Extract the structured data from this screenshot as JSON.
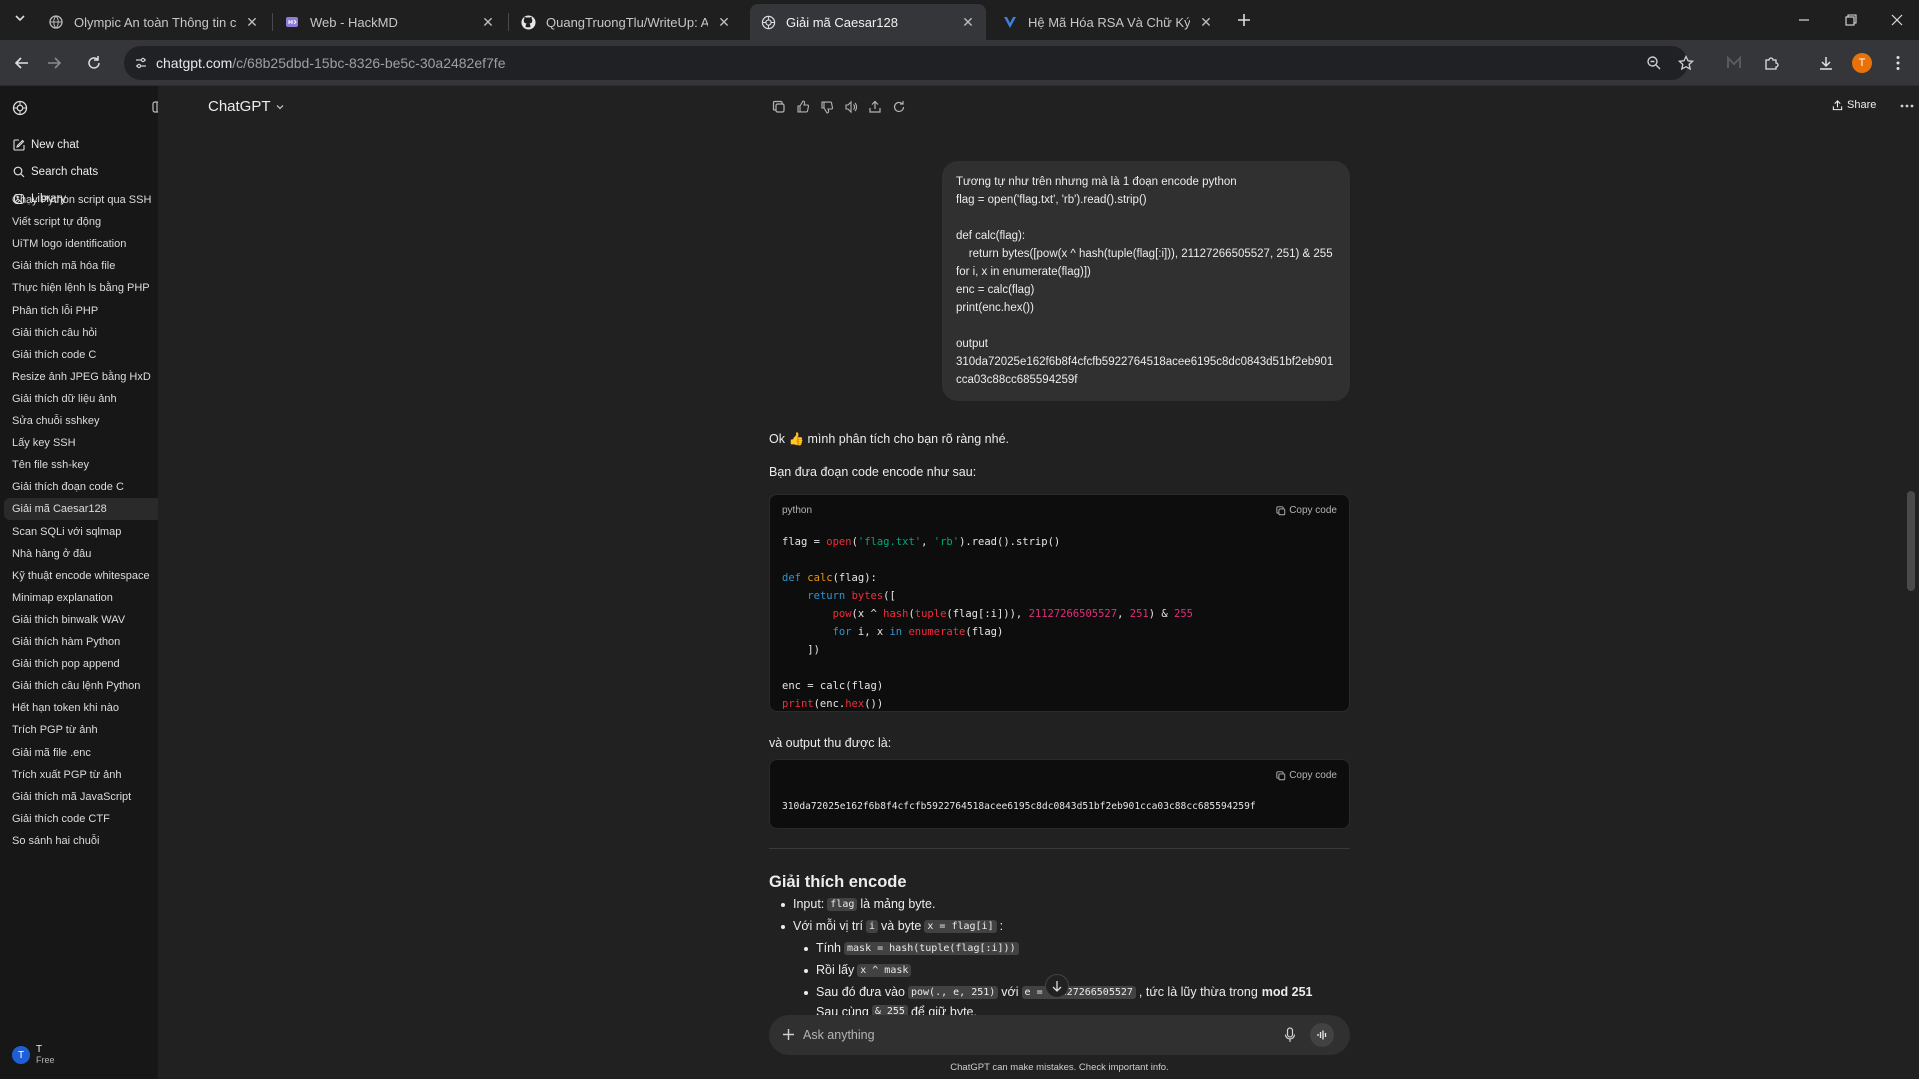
{
  "browser": {
    "tabs": [
      {
        "title": "Olympic An toàn Thông tin cấp",
        "active": false
      },
      {
        "title": "Web - HackMD",
        "active": false
      },
      {
        "title": "QuangTruongTlu/WriteUp: A pl",
        "active": false
      },
      {
        "title": "Giải mã Caesar128",
        "active": true
      },
      {
        "title": "Hệ Mã Hóa RSA Và Chữ Ký Số -",
        "active": false
      }
    ],
    "url_host": "chatgpt.com",
    "url_path": "/c/68b25dbd-15bc-8326-be5c-30a2482ef7fe",
    "profile_initial": "T"
  },
  "sidebar": {
    "new_chat": "New chat",
    "search_chats": "Search chats",
    "library": "Library",
    "chats": [
      "Chạy Python script qua SSH",
      "Viết script tự động",
      "UiTM logo identification",
      "Giải thích mã hóa file",
      "Thực hiện lệnh ls bằng PHP",
      "Phân tích lỗi PHP",
      "Giải thích câu hỏi",
      "Giải thích code C",
      "Resize ảnh JPEG bằng HxD",
      "Giải thích dữ liệu ảnh",
      "Sửa chuỗi sshkey",
      "Lấy key SSH",
      "Tên file ssh-key",
      "Giải thích đoạn code C",
      "Giải mã Caesar128",
      "Scan SQLi với sqlmap",
      "Nhà hàng ở đâu",
      "Kỹ thuật encode whitespace",
      "Minimap explanation",
      "Giải thích binwalk WAV",
      "Giải thích hàm Python",
      "Giải thích pop append",
      "Giải thích câu lệnh Python",
      "Hết hạn token khi nào",
      "Trích PGP từ ảnh",
      "Giải mã file .enc",
      "Trích xuất PGP từ ảnh",
      "Giải thích mã JavaScript",
      "Giải thích code CTF",
      "So sánh hai chuỗi"
    ],
    "active_chat_index": 14,
    "user_initial": "T",
    "user_name": "T",
    "user_plan": "Free"
  },
  "header": {
    "model": "ChatGPT",
    "share": "Share"
  },
  "conversation": {
    "user_message": "Tương tự như trên nhưng mà là 1 đoạn encode python\nflag = open('flag.txt', 'rb').read().strip()\n\ndef calc(flag):\n    return bytes([pow(x ^ hash(tuple(flag[:i])), 21127266505527, 251) & 255 for i, x in enumerate(flag)])\nenc = calc(flag)\nprint(enc.hex())\n\noutput\n310da72025e162f6b8f4cfcfb5922764518acee6195c8dc0843d51bf2eb901cca03c88cc685594259f",
    "intro1": "Ok 👍 mình phân tích cho bạn rõ ràng nhé.",
    "intro2": "Bạn đưa đoạn code encode như sau:",
    "code_lang": "python",
    "copy_label": "Copy code",
    "output_intro": "và output thu được là:",
    "output_hex": "310da72025e162f6b8f4cfcfb5922764518acee6195c8dc0843d51bf2eb901cca03c88cc685594259f",
    "section_title": "Giải thích encode",
    "b1_pre": "Input:",
    "b1_code": "flag",
    "b1_post": "là mảng byte.",
    "b2_pre": "Với mỗi vị trí",
    "b2_code1": "i",
    "b2_mid": "và byte",
    "b2_code2": "x = flag[i]",
    "b2_post": ":",
    "s1_pre": "Tính",
    "s1_code": "mask = hash(tuple(flag[:i]))",
    "s2_pre": "Rồi lấy",
    "s2_code": "x ^ mask",
    "s3_pre": "Sau đó đưa vào",
    "s3_code1": "pow(., e, 251)",
    "s3_mid": "với",
    "s3_code2": "e = 21127266505527",
    "s3_post": ", tức là lũy thừa trong",
    "s3_bold": "mod 251",
    "s4_pre": "Sau cùng",
    "s4_code": "& 255",
    "s4_post": "để giữ byte."
  },
  "composer": {
    "placeholder": "Ask anything",
    "disclaimer": "ChatGPT can make mistakes. Check important info."
  }
}
